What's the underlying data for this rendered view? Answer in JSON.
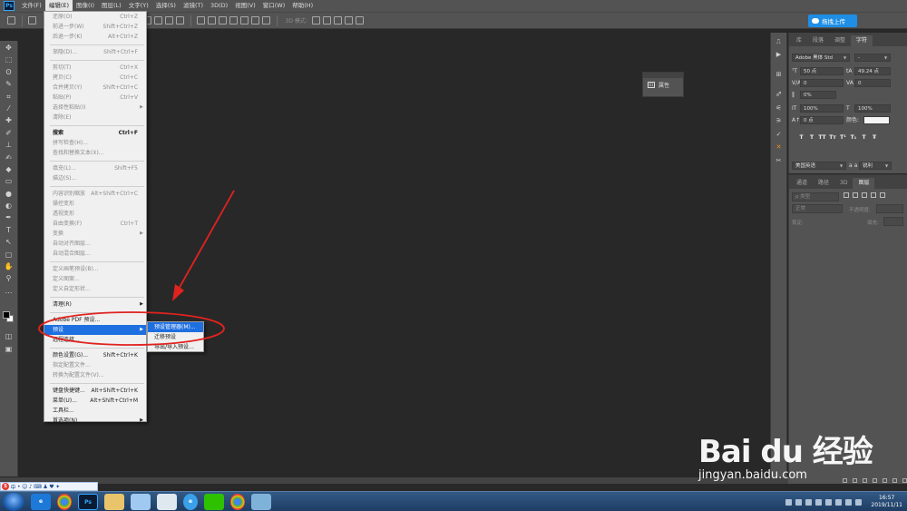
{
  "menubar": {
    "app_icon": "Ps",
    "items": [
      "文件(F)",
      "编辑(E)",
      "图像(I)",
      "图层(L)",
      "文字(Y)",
      "选择(S)",
      "滤镜(T)",
      "3D(D)",
      "视图(V)",
      "窗口(W)",
      "帮助(H)"
    ],
    "active_index": 1
  },
  "options": {
    "mode_3d": "3D 模式:",
    "upload_button": "拖拽上传"
  },
  "edit_menu": {
    "rows": [
      {
        "label": "还原(O)",
        "shortcut": "Ctrl+Z",
        "disabled": true
      },
      {
        "label": "前进一步(W)",
        "shortcut": "Shift+Ctrl+Z",
        "disabled": true
      },
      {
        "label": "后退一步(K)",
        "shortcut": "Alt+Ctrl+Z",
        "disabled": true
      },
      {
        "sep": true
      },
      {
        "label": "渐隐(D)...",
        "shortcut": "Shift+Ctrl+F",
        "disabled": true
      },
      {
        "sep": true
      },
      {
        "label": "剪切(T)",
        "shortcut": "Ctrl+X",
        "disabled": true
      },
      {
        "label": "拷贝(C)",
        "shortcut": "Ctrl+C",
        "disabled": true
      },
      {
        "label": "合并拷贝(Y)",
        "shortcut": "Shift+Ctrl+C",
        "disabled": true
      },
      {
        "label": "粘贴(P)",
        "shortcut": "Ctrl+V",
        "disabled": true
      },
      {
        "label": "选择性粘贴(I)",
        "shortcut": "",
        "disabled": true,
        "submenu": true
      },
      {
        "label": "清除(E)",
        "shortcut": "",
        "disabled": true
      },
      {
        "sep": true
      },
      {
        "label": "搜索",
        "shortcut": "Ctrl+F",
        "disabled": false,
        "bold": true
      },
      {
        "label": "拼写检查(H)...",
        "shortcut": "",
        "disabled": true
      },
      {
        "label": "查找和替换文本(X)...",
        "shortcut": "",
        "disabled": true
      },
      {
        "sep": true
      },
      {
        "label": "填充(L)...",
        "shortcut": "Shift+F5",
        "disabled": true
      },
      {
        "label": "描边(S)...",
        "shortcut": "",
        "disabled": true
      },
      {
        "sep": true
      },
      {
        "label": "内容识别缩放",
        "shortcut": "Alt+Shift+Ctrl+C",
        "disabled": true
      },
      {
        "label": "操控变形",
        "shortcut": "",
        "disabled": true
      },
      {
        "label": "透视变形",
        "shortcut": "",
        "disabled": true
      },
      {
        "label": "自由变换(F)",
        "shortcut": "Ctrl+T",
        "disabled": true
      },
      {
        "label": "变换",
        "shortcut": "",
        "disabled": true,
        "submenu": true
      },
      {
        "label": "自动对齐图层...",
        "shortcut": "",
        "disabled": true
      },
      {
        "label": "自动混合图层...",
        "shortcut": "",
        "disabled": true
      },
      {
        "sep": true
      },
      {
        "label": "定义画笔预设(B)...",
        "shortcut": "",
        "disabled": true
      },
      {
        "label": "定义图案...",
        "shortcut": "",
        "disabled": true
      },
      {
        "label": "定义自定形状...",
        "shortcut": "",
        "disabled": true
      },
      {
        "sep": true
      },
      {
        "label": "清理(R)",
        "shortcut": "",
        "disabled": false,
        "submenu": true
      },
      {
        "sep": true
      },
      {
        "label": "Adobe PDF 预设...",
        "shortcut": "",
        "disabled": false
      },
      {
        "label": "预设",
        "shortcut": "",
        "disabled": false,
        "submenu": true,
        "highlight": true
      },
      {
        "label": "远程连接...",
        "shortcut": "",
        "disabled": false
      },
      {
        "sep": true
      },
      {
        "label": "颜色设置(G)...",
        "shortcut": "Shift+Ctrl+K",
        "disabled": false
      },
      {
        "label": "指定配置文件...",
        "shortcut": "",
        "disabled": true
      },
      {
        "label": "转换为配置文件(V)...",
        "shortcut": "",
        "disabled": true
      },
      {
        "sep": true
      },
      {
        "label": "键盘快捷键...",
        "shortcut": "Alt+Shift+Ctrl+K",
        "disabled": false
      },
      {
        "label": "菜单(U)...",
        "shortcut": "Alt+Shift+Ctrl+M",
        "disabled": false
      },
      {
        "label": "工具栏...",
        "shortcut": "",
        "disabled": false
      },
      {
        "label": "首选项(N)",
        "shortcut": "",
        "disabled": false,
        "submenu": true
      }
    ]
  },
  "preset_submenu": {
    "items": [
      "预设管理器(M)...",
      "迁移预设",
      "导出/导入预设..."
    ],
    "highlight_index": 0
  },
  "properties_mini": {
    "label": "属性"
  },
  "char_panel": {
    "tabs": [
      "库",
      "段落",
      "调整",
      "字符"
    ],
    "active_tab": 3,
    "font_family": "Adobe 黑体 Std",
    "font_style": "-",
    "font_size": "50 点",
    "leading": "49.24 点",
    "kerning": "0",
    "tracking": "0",
    "vscale": "0%",
    "hscale_v": "100%",
    "hscale_h": "100%",
    "baseline": "0 点",
    "color_label": "颜色:",
    "style_buttons": [
      "T",
      "T",
      "TT",
      "Tт",
      "T¹",
      "T₁",
      "T",
      "Ŧ"
    ],
    "language": "美国英语",
    "aa_label": "a a",
    "aa_value": "锐利"
  },
  "layers_panel": {
    "tabs": [
      "通道",
      "路径",
      "3D",
      "图层"
    ],
    "active_tab": 3,
    "filter_label": "ρ 类型",
    "blend_mode": "正常",
    "opacity_label": "不透明度:",
    "lock_label": "锁定:",
    "fill_label": "填充:"
  },
  "ime_bar": {
    "label": "中"
  },
  "taskbar": {
    "ps_label": "Ps",
    "clock_time": "16:57",
    "clock_date": "2019/11/11"
  },
  "watermark": {
    "main": "Bai du 经验",
    "sub": "jingyan.baidu.com"
  },
  "colors": {
    "menu_highlight": "#1e6fe0",
    "annotation_red": "#e0231f",
    "ps_panel": "#535353",
    "canvas": "#282828"
  }
}
